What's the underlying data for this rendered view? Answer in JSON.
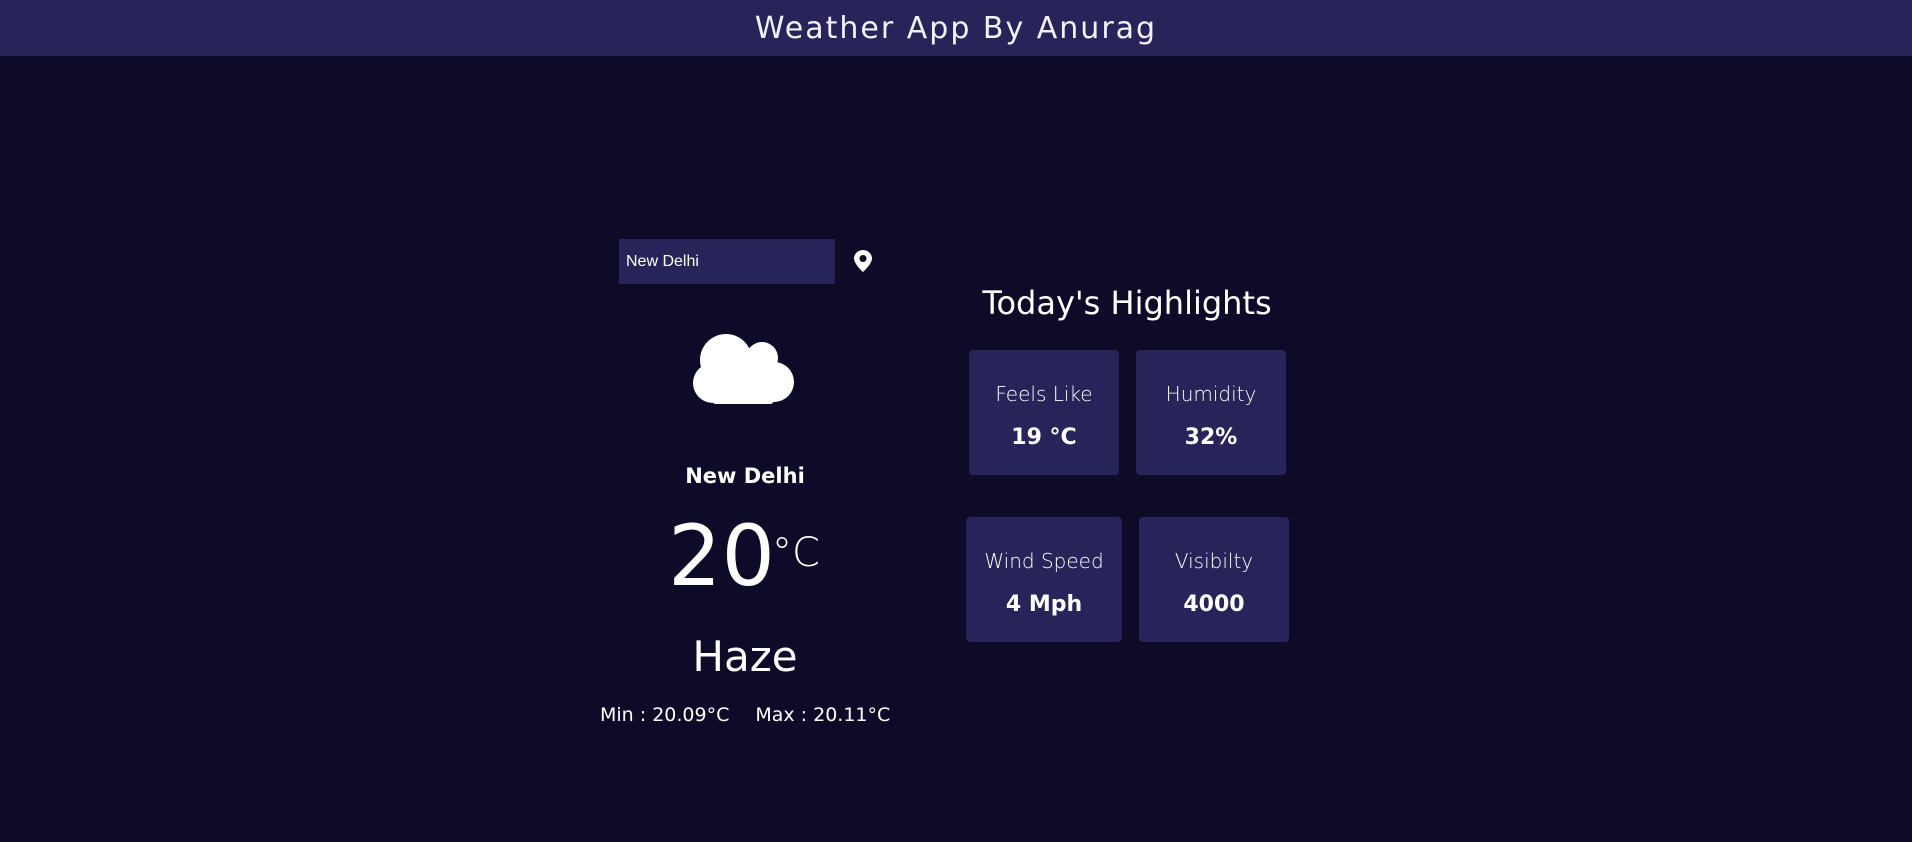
{
  "header": {
    "title": "Weather App By Anurag"
  },
  "search": {
    "value": "New Delhi"
  },
  "current": {
    "icon": "cloud-icon",
    "city": "New Delhi",
    "temperature": "20",
    "unit": "°C",
    "condition": "Haze",
    "min": "Min : 20.09°C",
    "max": "Max : 20.11°C"
  },
  "highlights": {
    "title": "Today's Highlights",
    "cards": [
      {
        "label": "Feels Like",
        "value": "19 °C"
      },
      {
        "label": "Humidity",
        "value": "32%"
      },
      {
        "label": "Wind Speed",
        "value": "4 Mph"
      },
      {
        "label": "Visibilty",
        "value": "4000"
      }
    ]
  },
  "colors": {
    "background": "#0d0b27",
    "panel": "#27245a",
    "text": "#ffffff"
  }
}
